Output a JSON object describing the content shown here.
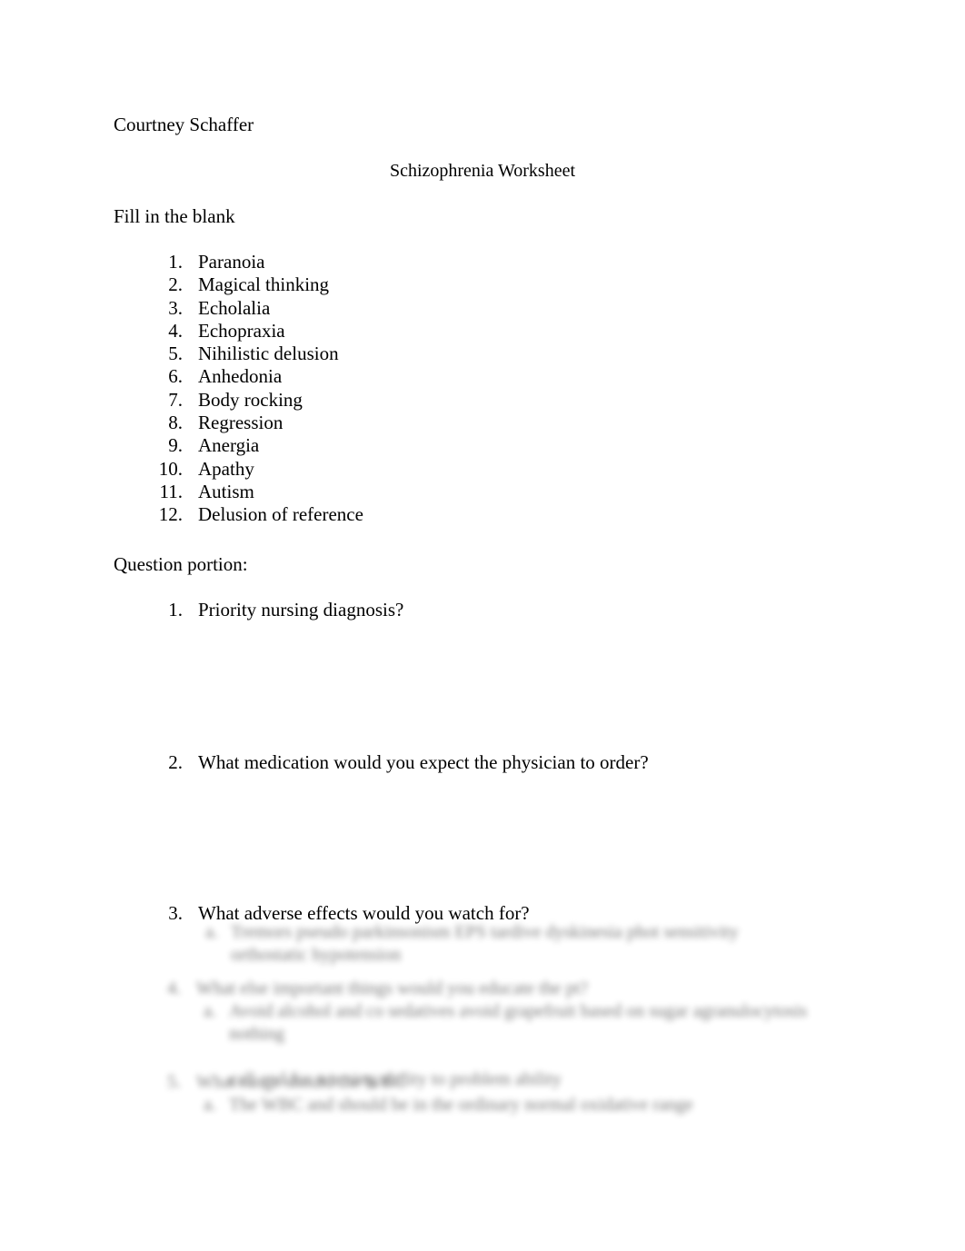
{
  "document": {
    "author": "Courtney Schaffer",
    "title": "Schizophrenia Worksheet"
  },
  "sections": {
    "fill_in_the_blank_label": "Fill in the blank",
    "question_portion_label": "Question portion:"
  },
  "fill_in_the_blank": {
    "items": [
      {
        "marker": "1.",
        "text": "Paranoia"
      },
      {
        "marker": "2.",
        "text": "Magical thinking"
      },
      {
        "marker": "3.",
        "text": "Echolalia"
      },
      {
        "marker": "4.",
        "text": "Echopraxia"
      },
      {
        "marker": "5.",
        "text": "Nihilistic delusion"
      },
      {
        "marker": "6.",
        "text": "Anhedonia"
      },
      {
        "marker": "7.",
        "text": "Body rocking"
      },
      {
        "marker": "8.",
        "text": "Regression"
      },
      {
        "marker": "9.",
        "text": "Anergia"
      },
      {
        "marker": "10.",
        "text": "Apathy"
      },
      {
        "marker": "11.",
        "text": "Autism"
      },
      {
        "marker": "12.",
        "text": "Delusion of reference"
      }
    ]
  },
  "questions": {
    "items": [
      {
        "marker": "1.",
        "text": "Priority nursing diagnosis?"
      },
      {
        "marker": "2.",
        "text": "What medication would you expect the physician to order?"
      },
      {
        "marker": "3.",
        "text": "What adverse effects would you watch for?"
      }
    ]
  },
  "redacted_answers": {
    "note": "illegible blurred text",
    "blocks": [
      {
        "marker": "",
        "heading": "",
        "subitems": [
          {
            "marker": "a.",
            "line1": "Tremors  pseudo parkinsonism  EPS  tardive dyskinesia  phot sensitivity",
            "line2": "orthostatic hypotension"
          }
        ]
      },
      {
        "marker": "4.",
        "heading": "What else important things would you educate the pt?",
        "subitems": [
          {
            "marker": "a.",
            "line1": "Avoid alcohol and co sedatives  avoid grapefruit based on sugar agranulocytosis nothing",
            "line2": "",
            "line3": "call and for warning ability to problem ability"
          }
        ]
      },
      {
        "marker": "5.",
        "heading": "What range should the WBC",
        "subitems": [
          {
            "marker": "a.",
            "line1": "The WBC and should be in the ordinary  normal oxidative range",
            "line2": ""
          }
        ]
      }
    ]
  }
}
